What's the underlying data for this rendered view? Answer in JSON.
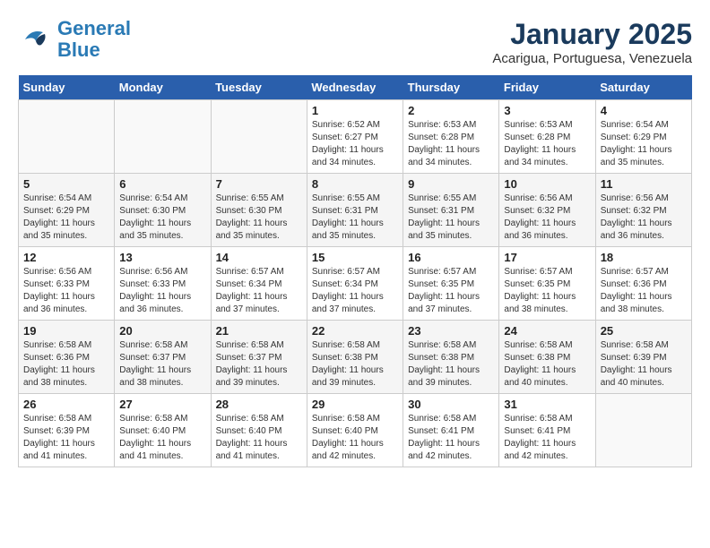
{
  "header": {
    "logo_general": "General",
    "logo_blue": "Blue",
    "month": "January 2025",
    "location": "Acarigua, Portuguesa, Venezuela"
  },
  "days_of_week": [
    "Sunday",
    "Monday",
    "Tuesday",
    "Wednesday",
    "Thursday",
    "Friday",
    "Saturday"
  ],
  "weeks": [
    [
      {
        "day": "",
        "info": ""
      },
      {
        "day": "",
        "info": ""
      },
      {
        "day": "",
        "info": ""
      },
      {
        "day": "1",
        "info": "Sunrise: 6:52 AM\nSunset: 6:27 PM\nDaylight: 11 hours and 34 minutes."
      },
      {
        "day": "2",
        "info": "Sunrise: 6:53 AM\nSunset: 6:28 PM\nDaylight: 11 hours and 34 minutes."
      },
      {
        "day": "3",
        "info": "Sunrise: 6:53 AM\nSunset: 6:28 PM\nDaylight: 11 hours and 34 minutes."
      },
      {
        "day": "4",
        "info": "Sunrise: 6:54 AM\nSunset: 6:29 PM\nDaylight: 11 hours and 35 minutes."
      }
    ],
    [
      {
        "day": "5",
        "info": "Sunrise: 6:54 AM\nSunset: 6:29 PM\nDaylight: 11 hours and 35 minutes."
      },
      {
        "day": "6",
        "info": "Sunrise: 6:54 AM\nSunset: 6:30 PM\nDaylight: 11 hours and 35 minutes."
      },
      {
        "day": "7",
        "info": "Sunrise: 6:55 AM\nSunset: 6:30 PM\nDaylight: 11 hours and 35 minutes."
      },
      {
        "day": "8",
        "info": "Sunrise: 6:55 AM\nSunset: 6:31 PM\nDaylight: 11 hours and 35 minutes."
      },
      {
        "day": "9",
        "info": "Sunrise: 6:55 AM\nSunset: 6:31 PM\nDaylight: 11 hours and 35 minutes."
      },
      {
        "day": "10",
        "info": "Sunrise: 6:56 AM\nSunset: 6:32 PM\nDaylight: 11 hours and 36 minutes."
      },
      {
        "day": "11",
        "info": "Sunrise: 6:56 AM\nSunset: 6:32 PM\nDaylight: 11 hours and 36 minutes."
      }
    ],
    [
      {
        "day": "12",
        "info": "Sunrise: 6:56 AM\nSunset: 6:33 PM\nDaylight: 11 hours and 36 minutes."
      },
      {
        "day": "13",
        "info": "Sunrise: 6:56 AM\nSunset: 6:33 PM\nDaylight: 11 hours and 36 minutes."
      },
      {
        "day": "14",
        "info": "Sunrise: 6:57 AM\nSunset: 6:34 PM\nDaylight: 11 hours and 37 minutes."
      },
      {
        "day": "15",
        "info": "Sunrise: 6:57 AM\nSunset: 6:34 PM\nDaylight: 11 hours and 37 minutes."
      },
      {
        "day": "16",
        "info": "Sunrise: 6:57 AM\nSunset: 6:35 PM\nDaylight: 11 hours and 37 minutes."
      },
      {
        "day": "17",
        "info": "Sunrise: 6:57 AM\nSunset: 6:35 PM\nDaylight: 11 hours and 38 minutes."
      },
      {
        "day": "18",
        "info": "Sunrise: 6:57 AM\nSunset: 6:36 PM\nDaylight: 11 hours and 38 minutes."
      }
    ],
    [
      {
        "day": "19",
        "info": "Sunrise: 6:58 AM\nSunset: 6:36 PM\nDaylight: 11 hours and 38 minutes."
      },
      {
        "day": "20",
        "info": "Sunrise: 6:58 AM\nSunset: 6:37 PM\nDaylight: 11 hours and 38 minutes."
      },
      {
        "day": "21",
        "info": "Sunrise: 6:58 AM\nSunset: 6:37 PM\nDaylight: 11 hours and 39 minutes."
      },
      {
        "day": "22",
        "info": "Sunrise: 6:58 AM\nSunset: 6:38 PM\nDaylight: 11 hours and 39 minutes."
      },
      {
        "day": "23",
        "info": "Sunrise: 6:58 AM\nSunset: 6:38 PM\nDaylight: 11 hours and 39 minutes."
      },
      {
        "day": "24",
        "info": "Sunrise: 6:58 AM\nSunset: 6:38 PM\nDaylight: 11 hours and 40 minutes."
      },
      {
        "day": "25",
        "info": "Sunrise: 6:58 AM\nSunset: 6:39 PM\nDaylight: 11 hours and 40 minutes."
      }
    ],
    [
      {
        "day": "26",
        "info": "Sunrise: 6:58 AM\nSunset: 6:39 PM\nDaylight: 11 hours and 41 minutes."
      },
      {
        "day": "27",
        "info": "Sunrise: 6:58 AM\nSunset: 6:40 PM\nDaylight: 11 hours and 41 minutes."
      },
      {
        "day": "28",
        "info": "Sunrise: 6:58 AM\nSunset: 6:40 PM\nDaylight: 11 hours and 41 minutes."
      },
      {
        "day": "29",
        "info": "Sunrise: 6:58 AM\nSunset: 6:40 PM\nDaylight: 11 hours and 42 minutes."
      },
      {
        "day": "30",
        "info": "Sunrise: 6:58 AM\nSunset: 6:41 PM\nDaylight: 11 hours and 42 minutes."
      },
      {
        "day": "31",
        "info": "Sunrise: 6:58 AM\nSunset: 6:41 PM\nDaylight: 11 hours and 42 minutes."
      },
      {
        "day": "",
        "info": ""
      }
    ]
  ]
}
